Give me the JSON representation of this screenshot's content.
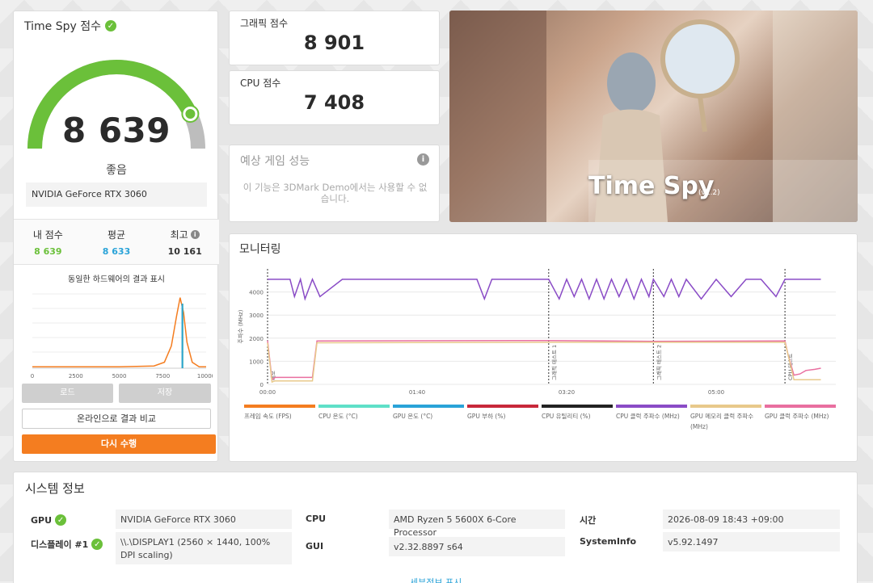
{
  "score": {
    "title": "Time Spy 점수",
    "value": "8 639",
    "gauge_fraction": 0.86,
    "rating": "좋음",
    "gpu": "NVIDIA GeForce RTX 3060",
    "stats": [
      {
        "label": "내 점수",
        "value": "8 639",
        "color": "#6bc03a"
      },
      {
        "label": "평균",
        "value": "8 633",
        "color": "#2aa3d8"
      },
      {
        "label": "최고",
        "value": "10 161",
        "color": "#333333"
      }
    ],
    "dist_title": "동일한 하드웨어의 결과 표시",
    "buttons": {
      "load": "로드",
      "save": "저장",
      "compare": "온라인으로 결과 비교",
      "rerun": "다시 수행"
    }
  },
  "dist_chart": {
    "type": "line",
    "x_ticks": [
      "0",
      "2500",
      "5000",
      "7500",
      "10000"
    ],
    "xlim": [
      0,
      10000
    ],
    "series": [
      {
        "x": [
          0,
          2500,
          5000,
          7000,
          7600,
          8000,
          8300,
          8500,
          8700,
          8900,
          9200,
          9600,
          10000
        ],
        "y": [
          0.02,
          0.02,
          0.02,
          0.03,
          0.08,
          0.3,
          0.7,
          0.95,
          0.75,
          0.35,
          0.08,
          0.02,
          0.02
        ]
      }
    ],
    "markers": [
      {
        "x": 8639,
        "color": "#6bc03a"
      },
      {
        "x": 8633,
        "color": "#2aa3d8"
      }
    ]
  },
  "graphics_card": {
    "label": "그래픽 점수",
    "value": "8 901"
  },
  "cpu_card": {
    "label": "CPU 점수",
    "value": "7 408"
  },
  "perf_card": {
    "label": "예상 게임 성능",
    "message": "이 기능은 3DMark Demo에서는 사용할 수 없습니다."
  },
  "banner": {
    "name": "Time Spy",
    "version": "(v1.2)"
  },
  "monitoring": {
    "title": "모니터링",
    "chart_data": {
      "type": "line",
      "ylabel": "주파수 (MHz)",
      "y_ticks": [
        "0",
        "1000",
        "2000",
        "3000",
        "4000"
      ],
      "ylim": [
        0,
        5000
      ],
      "x_ticks": [
        "00:00",
        "01:40",
        "03:20",
        "05:00"
      ],
      "xlim": [
        0,
        380
      ],
      "phases": [
        {
          "x": 0,
          "label": "데모"
        },
        {
          "x": 188,
          "label": "그래픽 테스트 1"
        },
        {
          "x": 258,
          "label": "그래픽 테스트 2"
        },
        {
          "x": 346,
          "label": "CPU 테스트"
        }
      ],
      "series": [
        {
          "name": "CPU 클럭 주파수 (MHz)",
          "color": "#8a4cc6",
          "x": [
            0,
            15,
            18,
            22,
            25,
            30,
            35,
            50,
            90,
            120,
            140,
            145,
            150,
            170,
            188,
            195,
            200,
            205,
            210,
            215,
            220,
            225,
            230,
            235,
            240,
            245,
            250,
            255,
            258,
            265,
            270,
            275,
            280,
            290,
            300,
            310,
            320,
            330,
            340,
            346,
            360,
            370
          ],
          "y": [
            4550,
            4550,
            3800,
            4550,
            3700,
            4550,
            3800,
            4550,
            4550,
            4550,
            4550,
            3700,
            4550,
            4550,
            4550,
            3700,
            4550,
            3800,
            4550,
            3700,
            4550,
            3700,
            4550,
            3800,
            4550,
            3700,
            4550,
            3800,
            4550,
            3800,
            4550,
            3800,
            4550,
            3700,
            4550,
            3800,
            4550,
            4550,
            3800,
            4550,
            4550,
            4550
          ]
        },
        {
          "name": "GPU 클럭 주파수 (MHz)",
          "color": "#e96fa0",
          "x": [
            0,
            3,
            5,
            30,
            33,
            188,
            258,
            346,
            348,
            352,
            356,
            360,
            366,
            370
          ],
          "y": [
            1900,
            200,
            300,
            300,
            1880,
            1900,
            1860,
            1880,
            1300,
            400,
            450,
            600,
            650,
            700
          ]
        },
        {
          "name": "GPU 메모리 클럭 주파수 (MHz)",
          "color": "#e8c98b",
          "x": [
            0,
            3,
            5,
            30,
            33,
            188,
            258,
            346,
            348,
            352,
            370
          ],
          "y": [
            1800,
            100,
            150,
            150,
            1800,
            1820,
            1820,
            1820,
            1300,
            200,
            200
          ]
        }
      ]
    },
    "legend": [
      {
        "name": "프레임 속도 (FPS)",
        "color": "#f47d20"
      },
      {
        "name": "CPU 온도 (°C)",
        "color": "#5fe0c8"
      },
      {
        "name": "GPU 온도 (°C)",
        "color": "#2aa3d8"
      },
      {
        "name": "GPU 부하 (%)",
        "color": "#c8283a"
      },
      {
        "name": "CPU 유틸리티 (%)",
        "color": "#222222"
      },
      {
        "name": "CPU 클럭 주파수 (MHz)",
        "color": "#8a4cc6"
      },
      {
        "name": "GPU 메모리 클럭 주파수 (MHz)",
        "color": "#e8c98b"
      },
      {
        "name": "GPU 클럭 주파수 (MHz)",
        "color": "#e96fa0"
      }
    ]
  },
  "sysinfo": {
    "title": "시스템 정보",
    "gpu_label": "GPU",
    "gpu_value": "NVIDIA GeForce RTX 3060",
    "display_label": "디스플레이 #1",
    "display_value": "\\\\.\\DISPLAY1 (2560 × 1440, 100% DPI scaling)",
    "cpu_label": "CPU",
    "cpu_value": "AMD Ryzen 5 5600X 6-Core Processor",
    "gui_label": "GUI",
    "gui_value": "v2.32.8897 s64",
    "time_label": "시간",
    "time_value": "2026-08-09 18:43 +09:00",
    "sysinfo_label": "SystemInfo",
    "sysinfo_value": "v5.92.1497",
    "detail_link": "세부정보 표시"
  }
}
